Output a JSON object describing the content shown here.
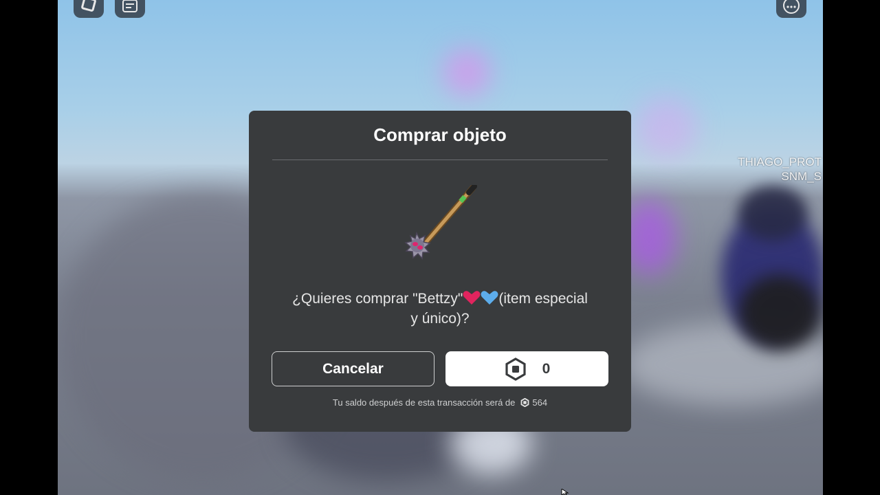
{
  "dialog": {
    "title": "Comprar objeto",
    "question": "¿Quieres comprar \"Bettzy\"❤️💙(item especial y único)?",
    "question_line1": "¿Quieres comprar \"Bettzy\"",
    "question_line1_end": "(item especial",
    "question_line2": "y único)?",
    "cancel_label": "Cancelar",
    "buy_price": "0",
    "balance_prefix": "Tu saldo después de esta transacción será de",
    "balance_amount": "564"
  },
  "scene": {
    "nametag_line1": "THIAGO_PROT",
    "nametag_line2": "SNM_S"
  },
  "topbar": {
    "icons": [
      "roblox-menu-icon",
      "chat-icon",
      "more-options-icon"
    ]
  },
  "colors": {
    "dialog_bg": "#393b3d",
    "heart_red": "#e0245e",
    "heart_blue": "#5dadec"
  }
}
